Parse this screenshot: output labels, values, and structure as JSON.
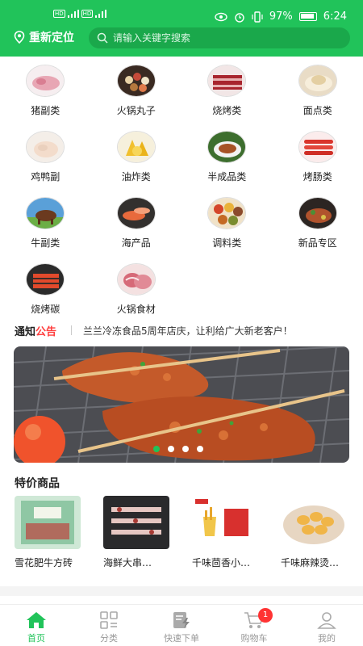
{
  "status_bar": {
    "battery": "97%",
    "time": "6:24",
    "sim1": "HD",
    "sim2": "HD",
    "net": "4G"
  },
  "header": {
    "relocate_label": "重新定位",
    "search_placeholder": "请输入关键字搜索"
  },
  "categories": [
    {
      "label": "猪副类",
      "icon": "pig-offal-icon"
    },
    {
      "label": "火锅丸子",
      "icon": "hotpot-balls-icon"
    },
    {
      "label": "烧烤类",
      "icon": "barbecue-icon"
    },
    {
      "label": "面点类",
      "icon": "dumplings-icon"
    },
    {
      "label": "鸡鸭副",
      "icon": "poultry-icon"
    },
    {
      "label": "油炸类",
      "icon": "fried-food-icon"
    },
    {
      "label": "半成品类",
      "icon": "semi-finished-icon"
    },
    {
      "label": "烤肠类",
      "icon": "sausage-icon"
    },
    {
      "label": "牛副类",
      "icon": "cattle-icon"
    },
    {
      "label": "海产品",
      "icon": "seafood-icon"
    },
    {
      "label": "调料类",
      "icon": "spices-icon"
    },
    {
      "label": "新品专区",
      "icon": "new-products-icon"
    },
    {
      "label": "烧烤碳",
      "icon": "charcoal-icon"
    },
    {
      "label": "火锅食材",
      "icon": "hotpot-meat-icon"
    }
  ],
  "notice": {
    "title_part1": "通知",
    "title_part2": "公告",
    "text": "兰兰冷冻食品5周年店庆，让利给广大新老客户！"
  },
  "banner": {
    "slides": 4,
    "active_slide": 0
  },
  "special": {
    "title": "特价商品",
    "products": [
      {
        "name": "雪花肥牛方砖"
      },
      {
        "name": "海鲜大串…"
      },
      {
        "name": "千味茴香小…"
      },
      {
        "name": "千味麻辣烫…"
      }
    ]
  },
  "tabbar": [
    {
      "label": "首页",
      "icon": "home-icon",
      "active": true
    },
    {
      "label": "分类",
      "icon": "category-icon",
      "active": false
    },
    {
      "label": "快速下单",
      "icon": "quick-order-icon",
      "active": false
    },
    {
      "label": "购物车",
      "icon": "cart-icon",
      "active": false,
      "badge": "1"
    },
    {
      "label": "我的",
      "icon": "user-icon",
      "active": false
    }
  ],
  "colors": {
    "brand": "#21c35a",
    "notice_accent": "#ff3d3d",
    "badge": "#ff3333"
  }
}
